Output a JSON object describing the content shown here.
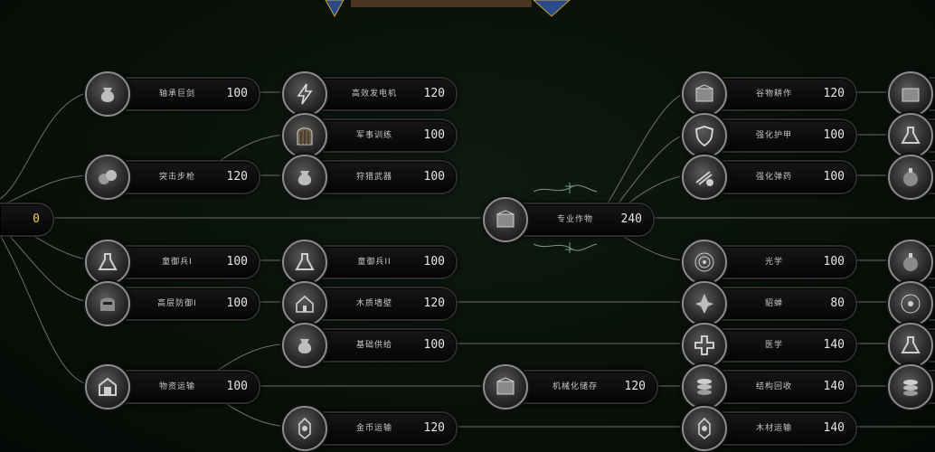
{
  "root": {
    "points": "0"
  },
  "hub": {
    "label": "专业作物",
    "cost": "240"
  },
  "left_col1": [
    {
      "label": "轴承巨剑",
      "cost": "100",
      "icon": "seed-bag-icon"
    },
    {
      "label": "突击步枪",
      "cost": "120",
      "icon": "gun-pile-icon"
    },
    {
      "label": "童御兵I",
      "cost": "100",
      "icon": "flask-icon"
    },
    {
      "label": "高层防御I",
      "cost": "100",
      "icon": "helmet-icon"
    },
    {
      "label": "物资运输",
      "cost": "100",
      "icon": "warehouse-icon"
    }
  ],
  "left_col2": [
    {
      "label": "高效发电机",
      "cost": "120",
      "icon": "lightning-icon"
    },
    {
      "label": "军事训练",
      "cost": "100",
      "icon": "gate-icon"
    },
    {
      "label": "狩猎武器",
      "cost": "100",
      "icon": "seed-bag-icon"
    },
    {
      "label": "童御兵II",
      "cost": "100",
      "icon": "flask-icon"
    },
    {
      "label": "木质墙壁",
      "cost": "120",
      "icon": "house-icon"
    },
    {
      "label": "基础供给",
      "cost": "100",
      "icon": "seed-bag-icon"
    },
    {
      "label": "金币运输",
      "cost": "120",
      "icon": "lantern-icon"
    }
  ],
  "mid_node": {
    "label": "机械化储存",
    "cost": "120",
    "icon": "crate-icon"
  },
  "right_col": [
    {
      "label": "谷物耕作",
      "cost": "120",
      "icon": "crate-icon"
    },
    {
      "label": "强化护甲",
      "cost": "100",
      "icon": "shield-icon"
    },
    {
      "label": "强化弹药",
      "cost": "100",
      "icon": "ammo-icon"
    },
    {
      "label": "光学",
      "cost": "100",
      "icon": "eye-icon"
    },
    {
      "label": "貂蝉",
      "cost": "80",
      "icon": "crystal-icon"
    },
    {
      "label": "医学",
      "cost": "140",
      "icon": "cross-icon"
    },
    {
      "label": "结构回收",
      "cost": "140",
      "icon": "coins-icon"
    },
    {
      "label": "木材运输",
      "cost": "140",
      "icon": "lantern-icon"
    }
  ],
  "right_edge": [
    {
      "icon": "crate-icon"
    },
    {
      "icon": "flask-icon"
    },
    {
      "icon": "grenade-icon"
    },
    {
      "icon": "grenade-icon"
    },
    {
      "icon": "eye-icon"
    },
    {
      "icon": "flask-icon"
    },
    {
      "icon": "coins-icon"
    }
  ]
}
